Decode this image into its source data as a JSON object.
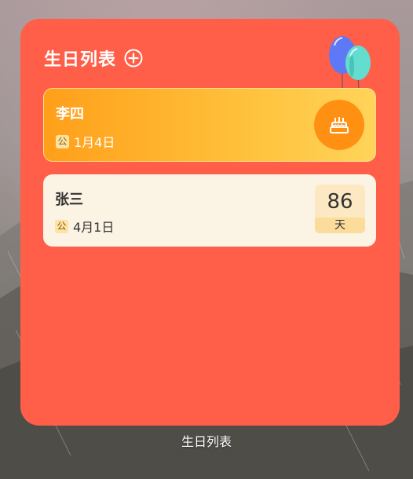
{
  "widget": {
    "title": "生日列表",
    "add_icon": "plus-circle-icon",
    "decoration_icon": "balloons-icon",
    "background_color": "#ff5f48"
  },
  "birthdays": [
    {
      "name": "李四",
      "calendar_badge": "公",
      "date": "1月4日",
      "status_icon": "birthday-cake-icon",
      "highlight": true
    },
    {
      "name": "张三",
      "calendar_badge": "公",
      "date": "4月1日",
      "days_left": "86",
      "days_unit": "天",
      "highlight": false
    }
  ],
  "caption": "生日列表"
}
